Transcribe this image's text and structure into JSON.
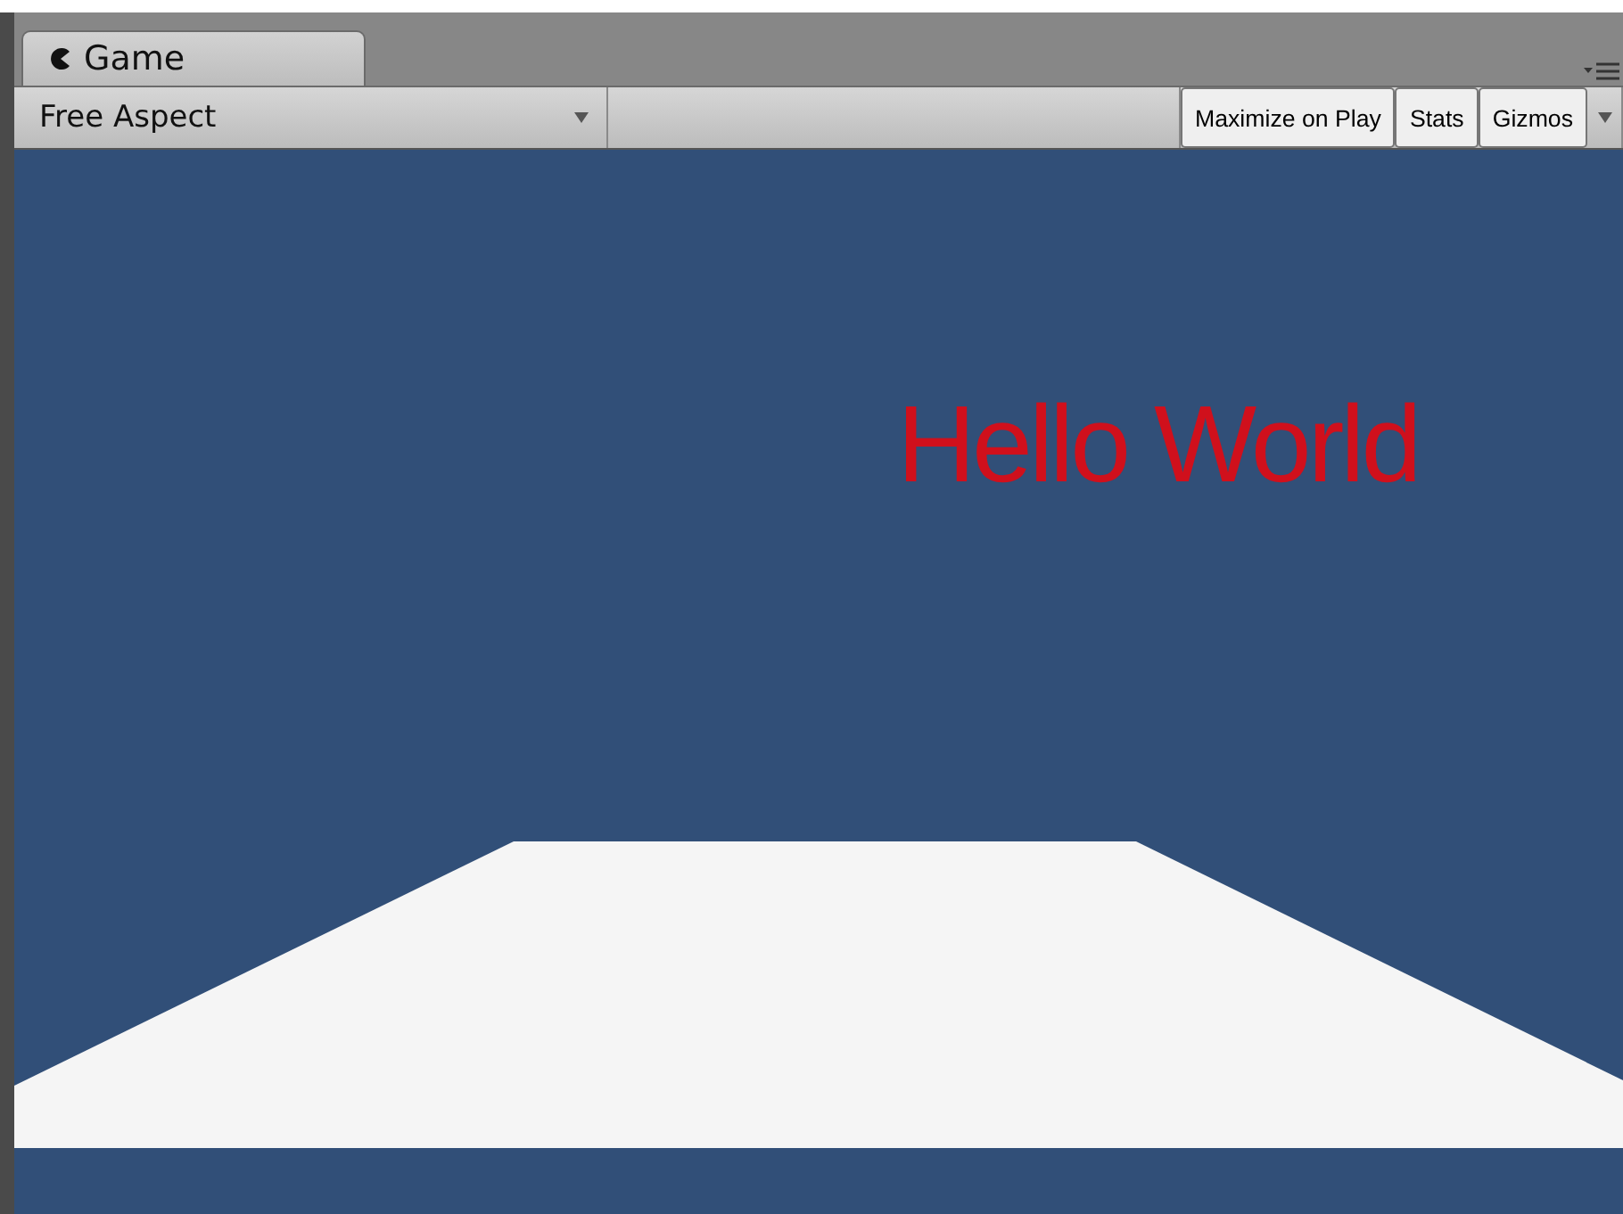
{
  "tab": {
    "label": "Game"
  },
  "toolbar": {
    "aspect": "Free Aspect",
    "buttons": [
      "Maximize on Play",
      "Stats",
      "Gizmos"
    ]
  },
  "game_view": {
    "text": "Hello World"
  }
}
